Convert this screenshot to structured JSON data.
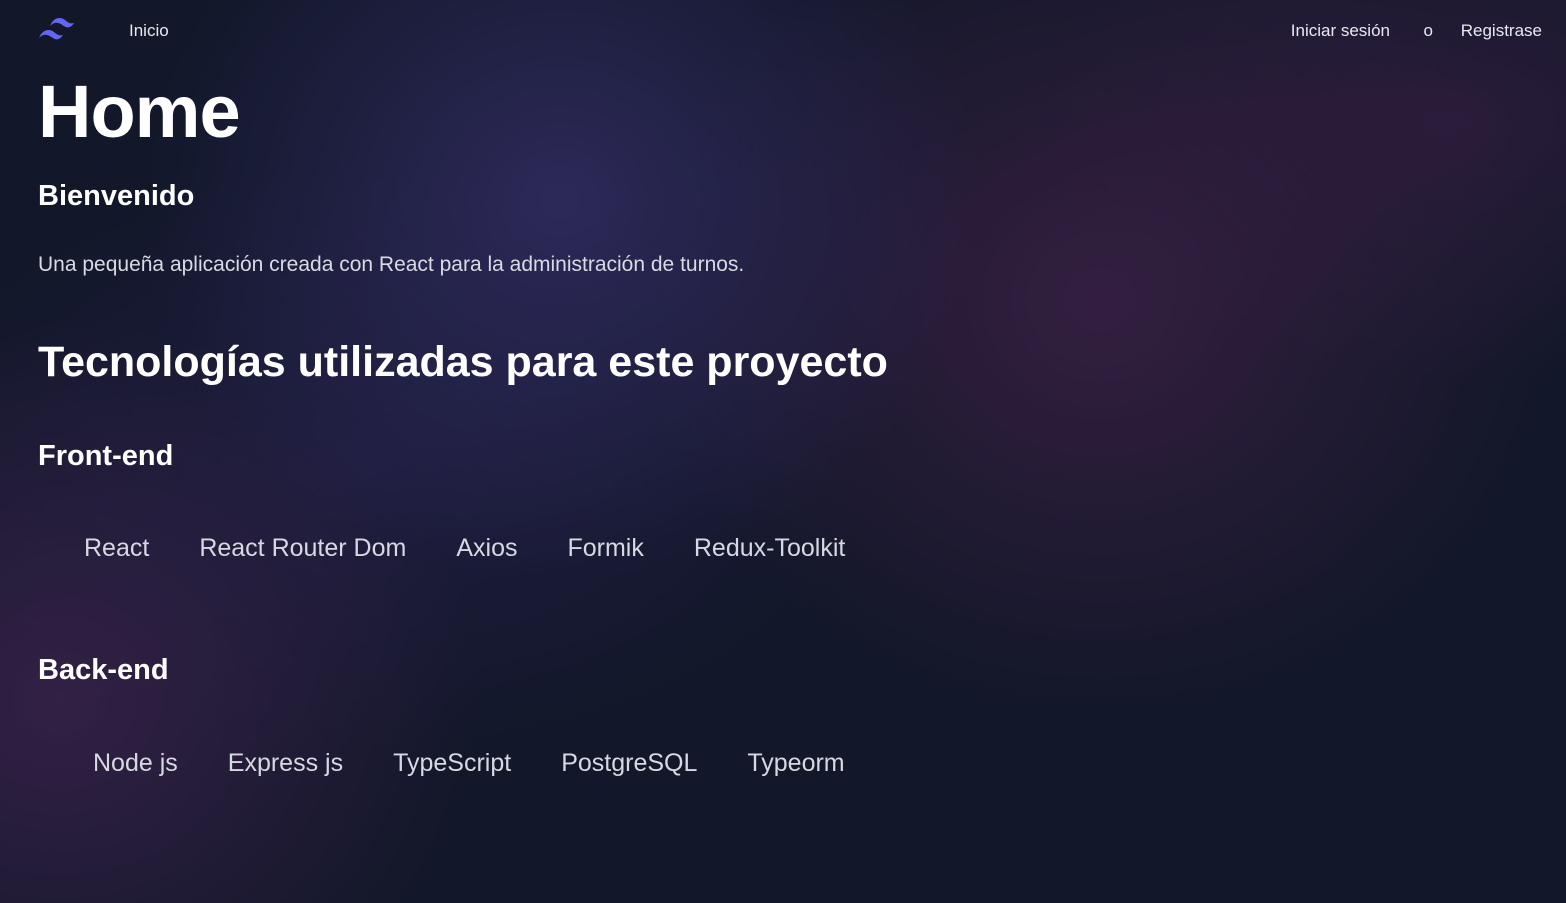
{
  "nav": {
    "logo_name": "tailwind-waves-logo",
    "home_label": "Inicio",
    "login_label": "Iniciar sesión",
    "separator": "o",
    "register_label": "Registrase"
  },
  "colors": {
    "background": "#121729",
    "logo_accent": "#6366f1",
    "text_primary": "#ffffff",
    "text_secondary": "#d8dae4"
  },
  "main": {
    "title": "Home",
    "welcome": "Bienvenido",
    "intro": "Una pequeña aplicación creada con React para la administración de turnos.",
    "tech_heading": "Tecnologías utilizadas para este proyecto",
    "frontend": {
      "heading": "Front-end",
      "items": [
        "React",
        "React Router Dom",
        "Axios",
        "Formik",
        "Redux-Toolkit"
      ]
    },
    "backend": {
      "heading": "Back-end",
      "items": [
        "Node js",
        "Express js",
        "TypeScript",
        "PostgreSQL",
        "Typeorm"
      ]
    }
  }
}
